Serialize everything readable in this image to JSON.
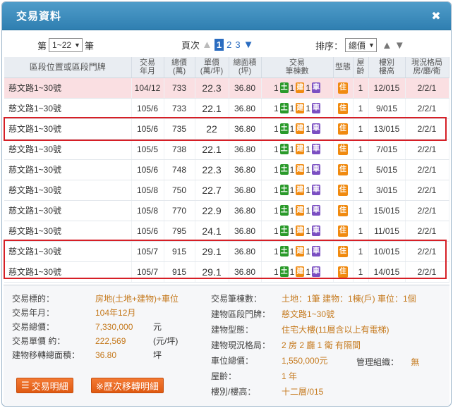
{
  "window": {
    "title": "交易資料"
  },
  "toolbar": {
    "page_prefix": "第",
    "page_range": "1~22",
    "page_suffix": "筆",
    "pages_label": "頁次",
    "pages": [
      "1",
      "2",
      "3"
    ],
    "current_page": "1",
    "sort_label": "排序：",
    "sort_value": "總價"
  },
  "table": {
    "headers": {
      "address": "區段位置或區段門牌",
      "date": [
        "交易",
        "年月"
      ],
      "total": [
        "總價",
        "(萬)"
      ],
      "unit": [
        "單價",
        "(萬/坪)"
      ],
      "area": [
        "總面積",
        "(坪)"
      ],
      "count": [
        "交易",
        "筆棟數"
      ],
      "type": "型態",
      "age": [
        "屋",
        "齡"
      ],
      "floor": [
        "樓別",
        "樓高"
      ],
      "layout": [
        "現況格局",
        "房/廳/衛"
      ]
    },
    "rows": [
      {
        "addr": "慈文路1~30號",
        "date": "104/12",
        "total": "733",
        "unit": "22.3",
        "area": "36.80",
        "land": "1",
        "bldg": "1",
        "car": "1",
        "type": "住",
        "age": "1",
        "floor": "12/015",
        "layout": "2/2/1",
        "highlight": true
      },
      {
        "addr": "慈文路1~30號",
        "date": "105/6",
        "total": "733",
        "unit": "22.1",
        "area": "36.80",
        "land": "1",
        "bldg": "1",
        "car": "1",
        "type": "住",
        "age": "1",
        "floor": "9/015",
        "layout": "2/2/1",
        "highlight": false
      },
      {
        "addr": "慈文路1~30號",
        "date": "105/6",
        "total": "735",
        "unit": "22",
        "area": "36.80",
        "land": "1",
        "bldg": "1",
        "car": "1",
        "type": "住",
        "age": "1",
        "floor": "13/015",
        "layout": "2/2/1",
        "highlight": false
      },
      {
        "addr": "慈文路1~30號",
        "date": "105/5",
        "total": "738",
        "unit": "22.1",
        "area": "36.80",
        "land": "1",
        "bldg": "1",
        "car": "1",
        "type": "住",
        "age": "1",
        "floor": "7/015",
        "layout": "2/2/1",
        "highlight": false
      },
      {
        "addr": "慈文路1~30號",
        "date": "105/6",
        "total": "748",
        "unit": "22.3",
        "area": "36.80",
        "land": "1",
        "bldg": "1",
        "car": "1",
        "type": "住",
        "age": "1",
        "floor": "5/015",
        "layout": "2/2/1",
        "highlight": false
      },
      {
        "addr": "慈文路1~30號",
        "date": "105/8",
        "total": "750",
        "unit": "22.7",
        "area": "36.80",
        "land": "1",
        "bldg": "1",
        "car": "1",
        "type": "住",
        "age": "1",
        "floor": "3/015",
        "layout": "2/2/1",
        "highlight": false
      },
      {
        "addr": "慈文路1~30號",
        "date": "105/8",
        "total": "770",
        "unit": "22.9",
        "area": "36.80",
        "land": "1",
        "bldg": "1",
        "car": "1",
        "type": "住",
        "age": "1",
        "floor": "15/015",
        "layout": "2/2/1",
        "highlight": false
      },
      {
        "addr": "慈文路1~30號",
        "date": "105/6",
        "total": "795",
        "unit": "24.1",
        "area": "36.80",
        "land": "1",
        "bldg": "1",
        "car": "1",
        "type": "住",
        "age": "1",
        "floor": "11/015",
        "layout": "2/2/1",
        "highlight": false
      },
      {
        "addr": "慈文路1~30號",
        "date": "105/7",
        "total": "915",
        "unit": "29.1",
        "area": "36.80",
        "land": "1",
        "bldg": "1",
        "car": "1",
        "type": "住",
        "age": "1",
        "floor": "10/015",
        "layout": "2/2/1",
        "highlight": false
      },
      {
        "addr": "慈文路1~30號",
        "date": "105/7",
        "total": "915",
        "unit": "29.1",
        "area": "36.80",
        "land": "1",
        "bldg": "1",
        "car": "1",
        "type": "住",
        "age": "1",
        "floor": "14/015",
        "layout": "2/2/1",
        "highlight": false
      }
    ],
    "badge_labels": {
      "land": "土",
      "bldg": "建",
      "car": "車"
    }
  },
  "detail": {
    "left": [
      {
        "label": "交易標的：",
        "value": "房地(土地+建物)+車位",
        "unit": ""
      },
      {
        "label": "交易年月：",
        "value": "104年12月",
        "unit": ""
      },
      {
        "label": "交易總價：",
        "value": "7,330,000",
        "unit": "元"
      },
      {
        "label": "交易單價 約：",
        "value": "222,569",
        "unit": "(元/坪)"
      },
      {
        "label": "建物移轉總面積：",
        "value": "36.80",
        "unit": "坪"
      }
    ],
    "right": [
      {
        "label": "交易筆棟數：",
        "value": "土地：1筆 建物：1棟(戶) 車位：1個"
      },
      {
        "label": "建物區段門牌：",
        "value": "慈文路1~30號"
      },
      {
        "label": "建物型態：",
        "value": "住宅大樓(11層含以上有電梯)"
      },
      {
        "label": "建物現況格局：",
        "value": "2 房 2 廳 1 衛 有隔間"
      },
      {
        "label": "車位總價：",
        "value": "1,550,000元"
      },
      {
        "label": "屋齡：",
        "value": "1 年"
      },
      {
        "label": "樓別/樓高：",
        "value": "十二層/015"
      }
    ],
    "management_label": "管理組織：",
    "management_value": "無",
    "buttons": {
      "trade_detail": "交易明細",
      "history": "※歷次移轉明細"
    }
  }
}
